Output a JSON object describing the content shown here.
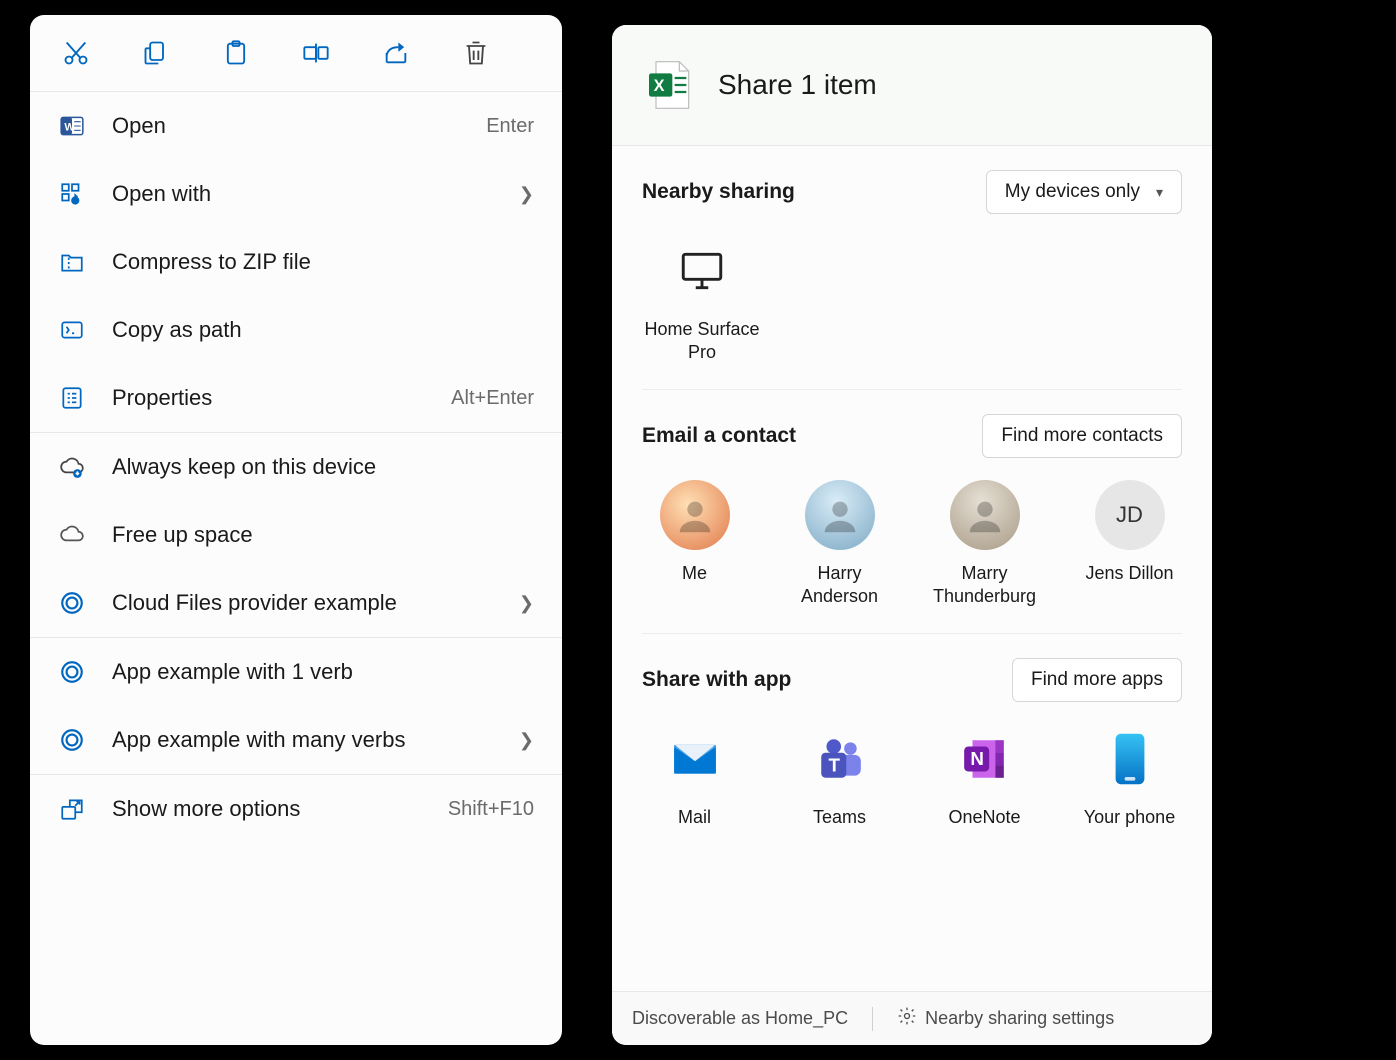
{
  "context_menu": {
    "toolbar": [
      {
        "name": "cut-icon"
      },
      {
        "name": "copy-icon"
      },
      {
        "name": "paste-icon"
      },
      {
        "name": "rename-icon"
      },
      {
        "name": "share-icon"
      },
      {
        "name": "delete-icon"
      }
    ],
    "groups": [
      [
        {
          "icon": "word-icon",
          "label": "Open",
          "accel": "Enter",
          "chevron": false
        },
        {
          "icon": "open-with-icon",
          "label": "Open with",
          "accel": "",
          "chevron": true
        },
        {
          "icon": "zip-icon",
          "label": "Compress to ZIP file",
          "accel": "",
          "chevron": false
        },
        {
          "icon": "copy-path-icon",
          "label": "Copy as path",
          "accel": "",
          "chevron": false
        },
        {
          "icon": "properties-icon",
          "label": "Properties",
          "accel": "Alt+Enter",
          "chevron": false
        }
      ],
      [
        {
          "icon": "cloud-keep-icon",
          "label": "Always keep on this device",
          "accel": "",
          "chevron": false
        },
        {
          "icon": "cloud-free-icon",
          "label": "Free up space",
          "accel": "",
          "chevron": false
        },
        {
          "icon": "cloud-provider-icon",
          "label": "Cloud Files provider example",
          "accel": "",
          "chevron": true
        }
      ],
      [
        {
          "icon": "app1-icon",
          "label": "App example with 1 verb",
          "accel": "",
          "chevron": false
        },
        {
          "icon": "app2-icon",
          "label": "App example with many verbs",
          "accel": "",
          "chevron": true
        }
      ],
      [
        {
          "icon": "more-icon",
          "label": "Show more options",
          "accel": "Shift+F10",
          "chevron": false
        }
      ]
    ]
  },
  "share": {
    "title": "Share 1 item",
    "nearby": {
      "title": "Nearby sharing",
      "selected": "My devices only",
      "devices": [
        {
          "name": "Home Surface Pro"
        }
      ]
    },
    "email": {
      "title": "Email a contact",
      "button": "Find more contacts",
      "contacts": [
        {
          "name": "Me",
          "avatar_bg": "#f4b183",
          "initials": ""
        },
        {
          "name": "Harry Anderson",
          "avatar_bg": "#cfe5f3",
          "initials": ""
        },
        {
          "name": "Marry Thunderburg",
          "avatar_bg": "#d9d2c9",
          "initials": ""
        },
        {
          "name": "Jens Dillon",
          "avatar_bg": "#e6e6e6",
          "initials": "JD"
        }
      ]
    },
    "apps": {
      "title": "Share with app",
      "button": "Find more apps",
      "list": [
        {
          "name": "Mail",
          "color": "#0078d4"
        },
        {
          "name": "Teams",
          "color": "#5059c9"
        },
        {
          "name": "OneNote",
          "color": "#7719aa"
        },
        {
          "name": "Your phone",
          "color": "#2f9de0"
        }
      ]
    },
    "footer": {
      "discoverable": "Discoverable as Home_PC",
      "settings": "Nearby sharing settings"
    }
  }
}
